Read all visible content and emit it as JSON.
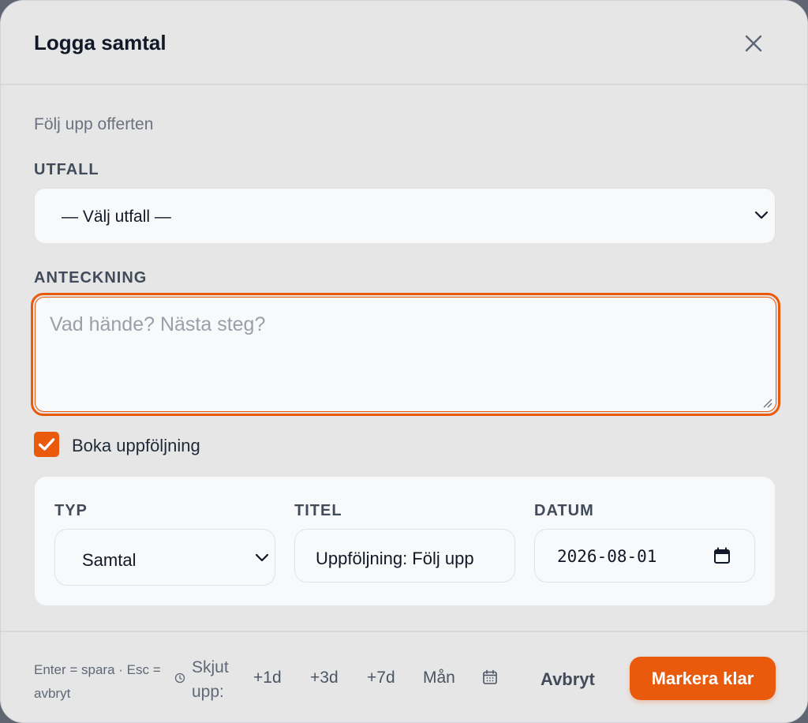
{
  "modal": {
    "title": "Logga samtal",
    "subtitle": "Följ upp offerten"
  },
  "outcome": {
    "label": "UTFALL",
    "selected": "— Välj utfall —"
  },
  "note": {
    "label": "ANTECKNING",
    "placeholder": "Vad hände? Nästa steg?"
  },
  "followup": {
    "checkbox_label": "Boka uppföljning",
    "checked": true,
    "type_label": "TYP",
    "type_value": "Samtal",
    "title_label": "TITEL",
    "title_value": "Uppföljning: Följ upp",
    "date_label": "DATUM",
    "date_value": "2026-08-01"
  },
  "footer": {
    "hint": "Enter = spara · Esc = avbryt",
    "snooze_label": "Skjut upp:",
    "snooze_options": [
      "+1d",
      "+3d",
      "+7d",
      "Mån"
    ],
    "cancel_label": "Avbryt",
    "primary_label": "Markera klar"
  },
  "colors": {
    "accent": "#ea5a0c",
    "modal_bg": "#e6e6e6",
    "field_bg": "#f8f9fa",
    "text": "#111827",
    "muted": "#6b7380"
  },
  "icons": {
    "close": "close-icon",
    "chevron": "chevron-down-icon",
    "check": "checkmark-icon",
    "calendar": "calendar-icon",
    "clock": "clock-icon",
    "resize": "resize-handle-icon"
  }
}
